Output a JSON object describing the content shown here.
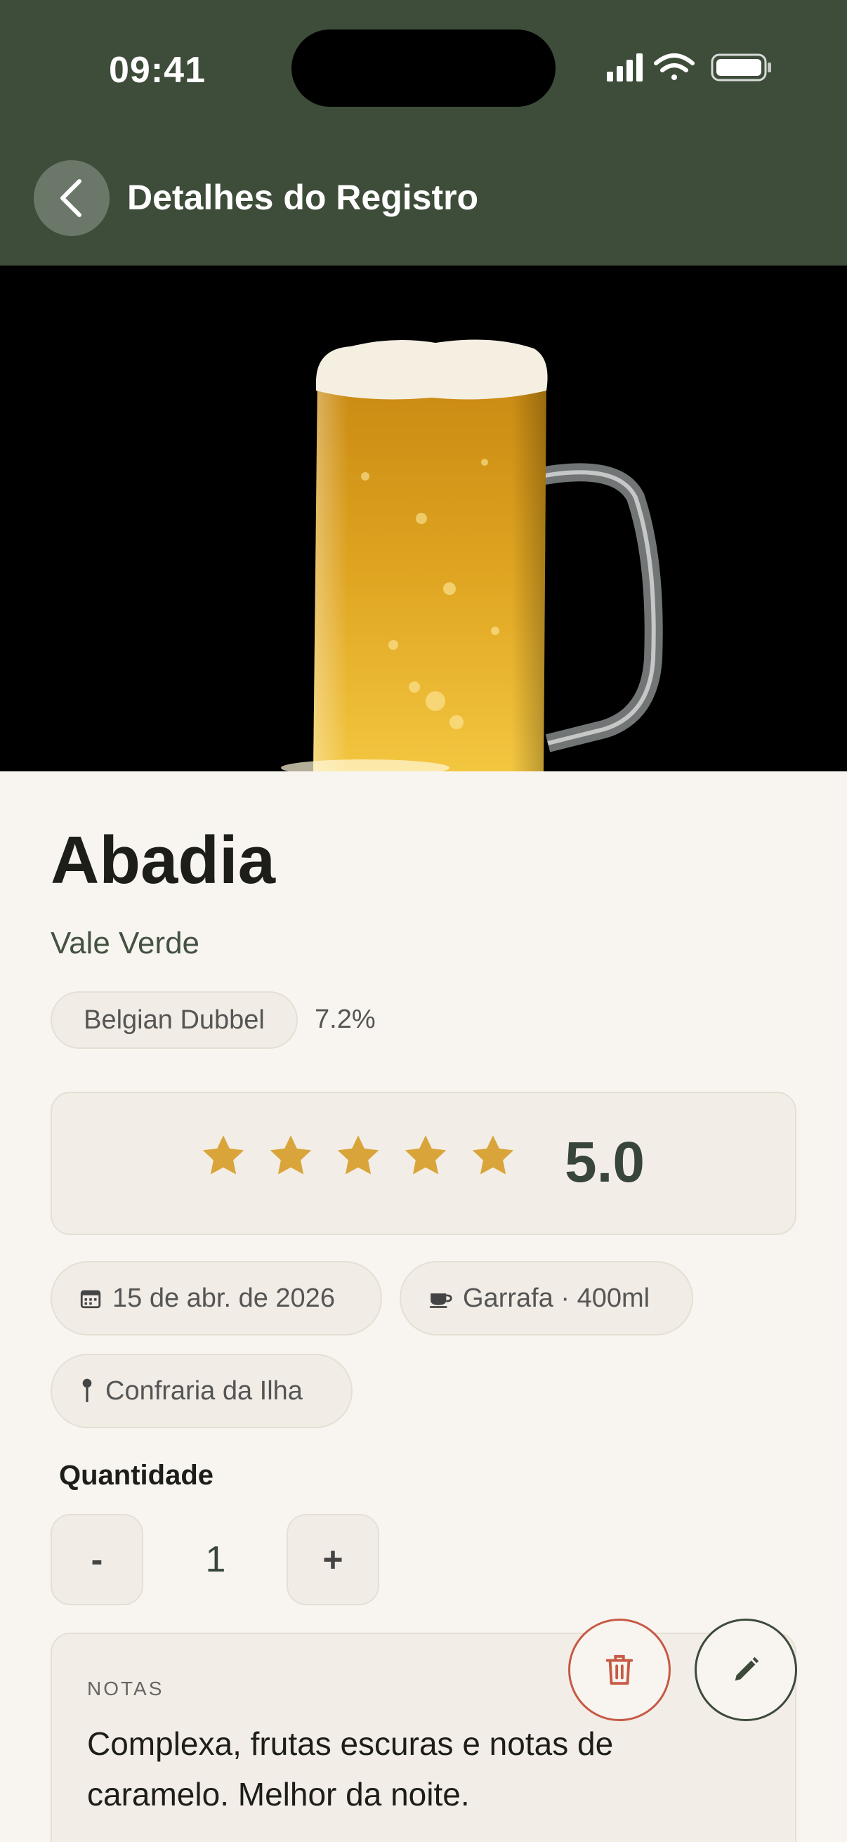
{
  "status_bar": {
    "time": "09:41"
  },
  "header": {
    "title": "Detalhes do Registro"
  },
  "beer": {
    "name": "Abadia",
    "brewery": "Vale Verde",
    "style": "Belgian Dubbel",
    "abv": "7.2%"
  },
  "rating": {
    "stars": 5,
    "value": "5.0"
  },
  "chips": {
    "date": "15 de abr. de 2026",
    "vessel": "Garrafa · 400ml",
    "place": "Confraria da Ilha"
  },
  "quantity": {
    "label": "Quantidade",
    "minus": "-",
    "plus": "+",
    "value": "1"
  },
  "notes": {
    "label": "NOTAS",
    "text": "Complexa, frutas escuras e notas de caramelo. Melhor da noite."
  },
  "colors": {
    "header_bg": "#3e4c3a",
    "star": "#d9a53b",
    "delete": "#c65a45"
  },
  "icons": {
    "back": "chevron-left-icon",
    "date": "calendar-icon",
    "vessel": "cup-icon",
    "place": "pin-icon",
    "delete": "trash-icon",
    "edit": "pencil-icon"
  }
}
